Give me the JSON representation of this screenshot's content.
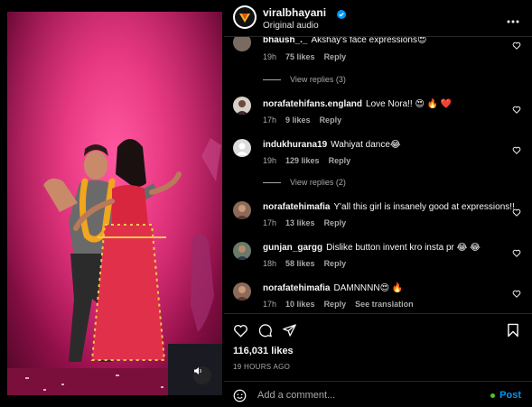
{
  "post": {
    "username": "viralbhayani",
    "subtitle": "Original audio"
  },
  "comments": [
    {
      "user": "bhaush_._",
      "text": "Akshay's face expressions😍",
      "time": "19h",
      "likes": "75 likes",
      "reply": "Reply"
    },
    {
      "user": "norafatehifans.england",
      "text": "Love Nora!! 😍 🔥 ❤️",
      "time": "17h",
      "likes": "9 likes",
      "reply": "Reply"
    },
    {
      "user": "indukhurana19",
      "text": "Wahiyat dance😂",
      "time": "19h",
      "likes": "129 likes",
      "reply": "Reply"
    },
    {
      "user": "norafatehimafia",
      "text": "Y'all this girl is insanely good at expressions!!",
      "time": "17h",
      "likes": "13 likes",
      "reply": "Reply"
    },
    {
      "user": "gunjan_gargg",
      "text": "Dislike button invent kro insta pr 😂 😂",
      "time": "18h",
      "likes": "58 likes",
      "reply": "Reply"
    },
    {
      "user": "norafatehimafia",
      "text": "DAMNNNN😍 🔥",
      "time": "17h",
      "likes": "10 likes",
      "reply": "Reply",
      "extra": "See translation"
    }
  ],
  "view_replies": [
    "View replies (3)",
    "View replies (2)"
  ],
  "likes_count": "116,031 likes",
  "timestamp": "19 HOURS AGO",
  "add_comment_placeholder": "Add a comment...",
  "post_button": "Post",
  "icons": {
    "verified": "verified-badge-icon",
    "more": "more-options-icon",
    "heart": "heart-icon",
    "comment": "comment-icon",
    "share": "share-icon",
    "save": "bookmark-icon",
    "emoji": "emoji-icon",
    "mute": "speaker-icon"
  },
  "colors": {
    "background": "#000000",
    "text": "#f5f5f5",
    "muted": "#a8a8a8",
    "link": "#0095f6",
    "verified": "#0095f6",
    "online_dot": "#58c322",
    "stage": "#d81d6b"
  }
}
